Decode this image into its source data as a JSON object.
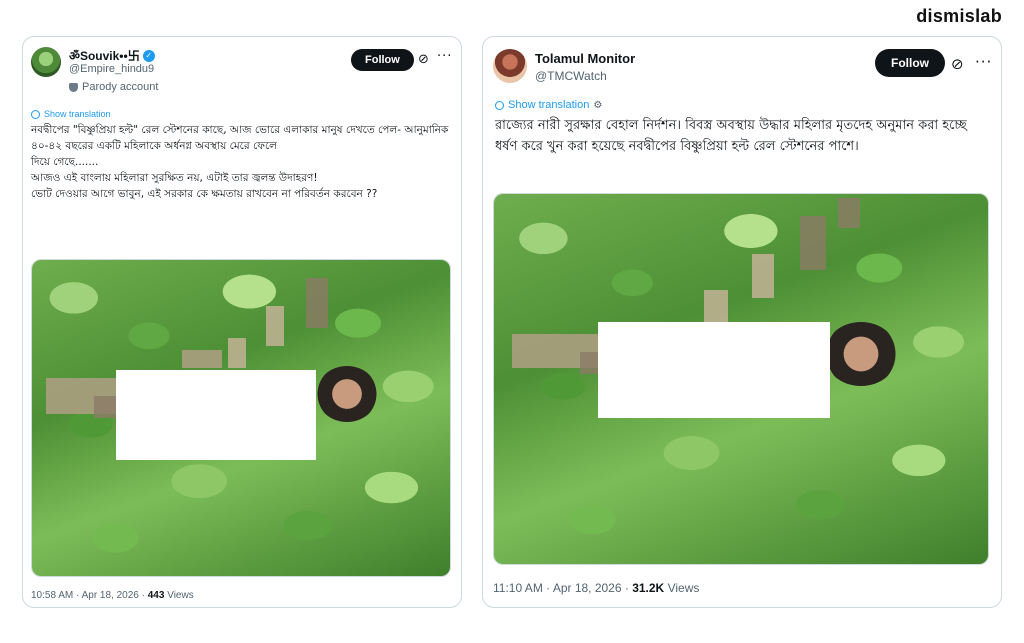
{
  "brand": "dismislab",
  "tweets": [
    {
      "display_name": "ॐSouvik••卐",
      "handle": "@Empire_hindu9",
      "badge": "Parody account",
      "follow_label": "Follow",
      "translate_label": "Show translation",
      "text": "নবদ্বীপের \"বিষ্ণুপ্রিয়া হল্ট\" রেল স্টেশনের কাছে, আজ ভোরে এলাকার মানুষ দেখতে পেল- আনুমানিক ৪০-৪২ বছরের একটি মহিলাকে অর্ধনগ্ন অবস্থায় মেরে ফেলে\nদিয়ে গেছে.......\nআজও এই বাংলায় মহিলারা সুরক্ষিত নয়, এটাই তার জ্বলন্ত উদাহরণ!\nভোট দেওয়ার আগে ভাবুন, এই সরকার কে ক্ষমতায় রাখবেন না পরিবর্তন করবেন ??",
      "time": "10:58 AM · Apr 18, 2026 · ",
      "views": "443",
      "views_label": " Views",
      "icons": [
        "verified-icon",
        "parody-mask-icon",
        "grok-icon",
        "more-icon",
        "globe-icon"
      ]
    },
    {
      "display_name": "Tolamul Monitor",
      "handle": "@TMCWatch",
      "follow_label": "Follow",
      "translate_label": "Show translation",
      "text": "রাজ্যের নারী সুরক্ষার বেহাল নির্দশন। বিবস্ত্র অবস্থায় উদ্ধার মহিলার মৃতদেহ অনুমান করা হচ্ছে ধর্ষণ করে খুন করা হয়েছে নবদ্বীপের বিষ্ণুপ্রিয়া হল্ট রেল স্টেশনের পাশে।",
      "time": "11:10 AM · Apr 18, 2026 · ",
      "views": "31.2K",
      "views_label": " Views",
      "icons": [
        "grok-icon",
        "more-icon",
        "globe-icon",
        "gear-icon"
      ]
    }
  ],
  "colors": {
    "accent": "#1d9bf0",
    "button": "#0f1419",
    "muted": "#536471"
  }
}
